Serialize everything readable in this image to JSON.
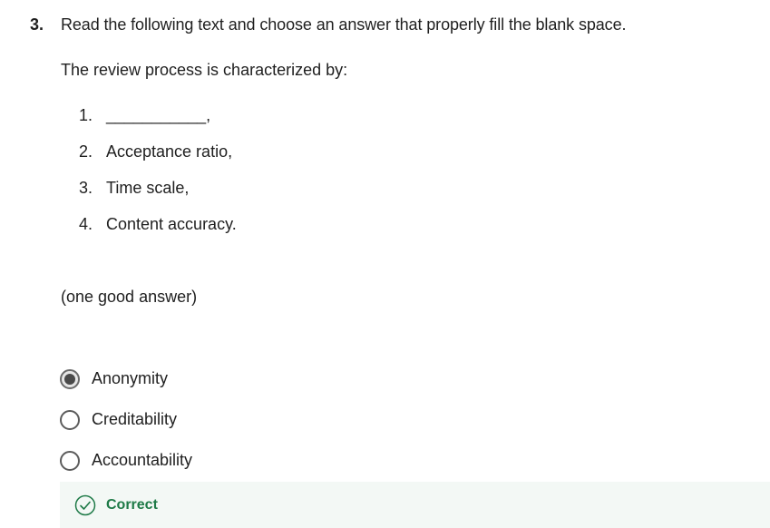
{
  "question": {
    "number": "3.",
    "text": "Read the following text and choose an answer that properly fill the blank space.",
    "intro": "The review process is characterized by:",
    "list": [
      {
        "num": "1.",
        "text": "___________,"
      },
      {
        "num": "2.",
        "text": "Acceptance ratio,"
      },
      {
        "num": "3.",
        "text": "Time scale,"
      },
      {
        "num": "4.",
        "text": "Content accuracy."
      }
    ],
    "hint": "(one good answer)"
  },
  "options": [
    {
      "label": "Anonymity",
      "selected": true
    },
    {
      "label": "Creditability",
      "selected": false
    },
    {
      "label": "Accountability",
      "selected": false
    }
  ],
  "feedback": {
    "label": "Correct",
    "icon": "check-circle-icon",
    "color": "#1e7a47"
  }
}
